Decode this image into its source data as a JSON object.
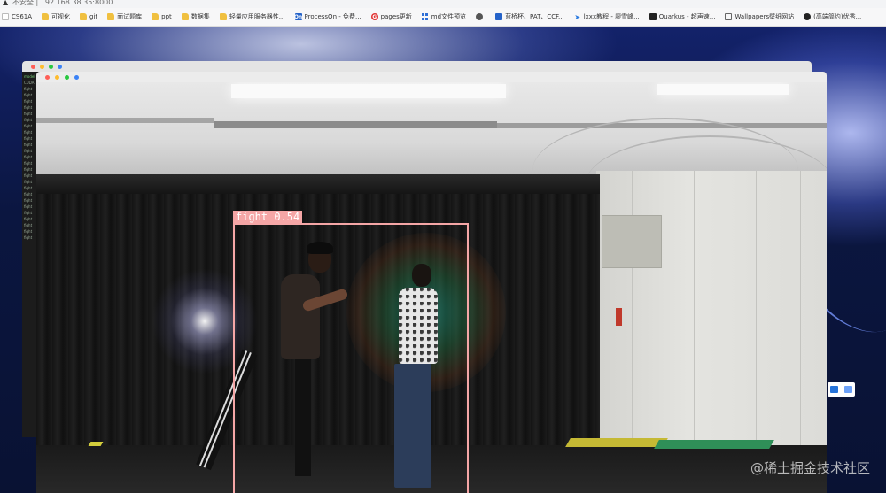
{
  "browser": {
    "address_text": "不安全 | 192.168.38.35:8000",
    "bookmarks": [
      {
        "label": "CS61A",
        "icon": "blank-page-icon"
      },
      {
        "label": "可视化",
        "icon": "folder-icon"
      },
      {
        "label": "git",
        "icon": "folder-icon"
      },
      {
        "label": "面试题库",
        "icon": "folder-icon"
      },
      {
        "label": "ppt",
        "icon": "folder-icon"
      },
      {
        "label": "数据集",
        "icon": "folder-icon"
      },
      {
        "label": "轻量应用服务器性...",
        "icon": "server-folder-icon"
      },
      {
        "label": "ProcessOn - 免费...",
        "icon": "processon-icon"
      },
      {
        "label": "pages更新",
        "icon": "red-circle-icon"
      },
      {
        "label": "md文件预览",
        "icon": "grid-app-icon"
      },
      {
        "label": "",
        "icon": "globe-icon"
      },
      {
        "label": "蓝桥杯、PAT、CCF...",
        "icon": "blue-square-icon"
      },
      {
        "label": "lxxx教程 - 廖雪峰...",
        "icon": "paper-plane-icon"
      },
      {
        "label": "Quarkus - 超声速...",
        "icon": "quarkus-icon"
      },
      {
        "label": "Wallpapers壁纸网站",
        "icon": "wallpaper-icon"
      },
      {
        "label": "(高端简约)优秀...",
        "icon": "github-icon"
      }
    ]
  },
  "video": {
    "detection": {
      "label": "fight",
      "score": "0.54",
      "box_color": "#f5a6a6"
    }
  },
  "watermark": "@稀土掘金技术社区",
  "terminal_lines": [
    "model",
    "CUDA",
    "fight",
    "fight",
    "fight",
    "fight",
    "fight",
    "fight",
    "fight",
    "fight",
    "fight",
    "fight",
    "fight",
    "fight",
    "fight",
    "fight",
    "fight",
    "fight",
    "fight",
    "fight",
    "fight",
    "fight",
    "fight",
    "fight",
    "fight",
    "fight",
    "fight"
  ]
}
